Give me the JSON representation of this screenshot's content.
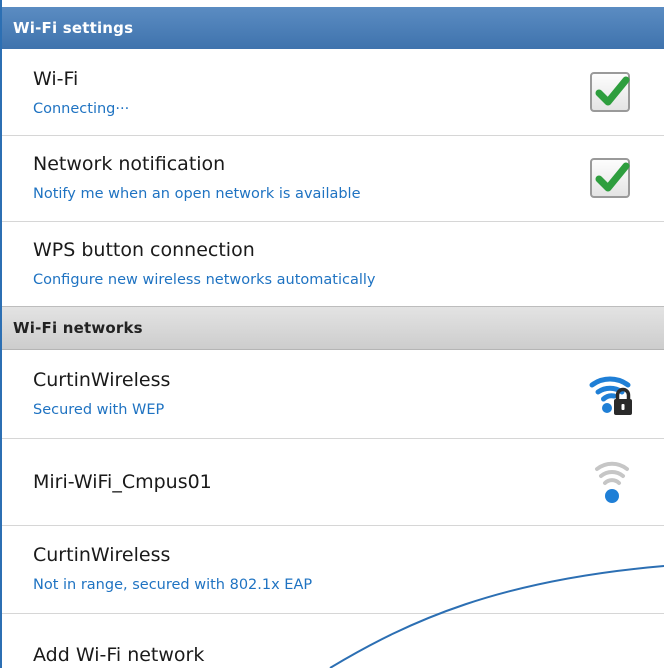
{
  "wifi_settings": {
    "header": "Wi-Fi settings",
    "items": [
      {
        "title": "Wi-Fi",
        "subtitle": "Connecting···",
        "checked": true
      },
      {
        "title": "Network notification",
        "subtitle": "Notify me when an open network is available",
        "checked": true
      },
      {
        "title": "WPS button connection",
        "subtitle": "Configure new wireless networks automatically"
      }
    ]
  },
  "wifi_networks": {
    "header": "Wi-Fi networks",
    "items": [
      {
        "ssid": "CurtinWireless",
        "status": "Secured with WEP",
        "icon": "wifi-locked-icon",
        "signal": "full"
      },
      {
        "ssid": "Miri-WiFi_Cmpus01",
        "icon": "wifi-icon",
        "signal": "weak"
      },
      {
        "ssid": "CurtinWireless",
        "status": "Not in range, secured with 802.1x EAP"
      }
    ],
    "add_label": "Add Wi-Fi network"
  },
  "colors": {
    "accent": "#1f73c2",
    "header_blue": "#4a7db5",
    "check_green": "#2e9e3e"
  }
}
